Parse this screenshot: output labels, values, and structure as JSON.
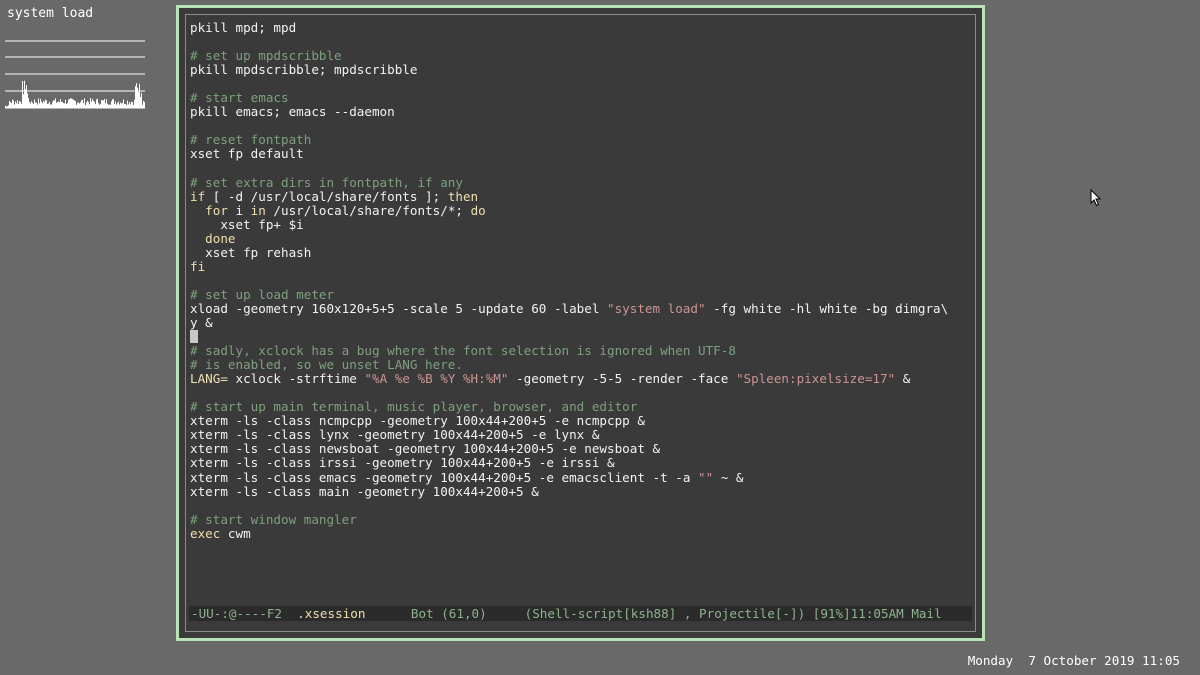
{
  "xload": {
    "label": "system load"
  },
  "editor": {
    "lines": [
      [
        {
          "t": "pkill mpd; mpd",
          "c": ""
        }
      ],
      [],
      [
        {
          "t": "# set up mpdscribble",
          "c": "cmt"
        }
      ],
      [
        {
          "t": "pkill mpdscribble; mpdscribble",
          "c": ""
        }
      ],
      [],
      [
        {
          "t": "# start emacs",
          "c": "cmt"
        }
      ],
      [
        {
          "t": "pkill emacs; emacs --daemon",
          "c": ""
        }
      ],
      [],
      [
        {
          "t": "# reset fontpath",
          "c": "cmt"
        }
      ],
      [
        {
          "t": "xset fp default",
          "c": ""
        }
      ],
      [],
      [
        {
          "t": "# set extra dirs in fontpath, if any",
          "c": "cmt"
        }
      ],
      [
        {
          "t": "if",
          "c": "kw"
        },
        {
          "t": " [ -d /usr/local/share/fonts ]; ",
          "c": ""
        },
        {
          "t": "then",
          "c": "kw"
        }
      ],
      [
        {
          "t": "  ",
          "c": ""
        },
        {
          "t": "for",
          "c": "kw"
        },
        {
          "t": " i ",
          "c": ""
        },
        {
          "t": "in",
          "c": "kw"
        },
        {
          "t": " /usr/local/share/fonts/*; ",
          "c": ""
        },
        {
          "t": "do",
          "c": "kw"
        }
      ],
      [
        {
          "t": "    xset fp+ $i",
          "c": ""
        }
      ],
      [
        {
          "t": "  ",
          "c": ""
        },
        {
          "t": "done",
          "c": "kw"
        }
      ],
      [
        {
          "t": "  xset fp rehash",
          "c": ""
        }
      ],
      [
        {
          "t": "fi",
          "c": "kw"
        }
      ],
      [],
      [
        {
          "t": "# set up load meter",
          "c": "cmt"
        }
      ],
      [
        {
          "t": "xload -geometry 160x120+5+5 -scale 5 -update 60 -label ",
          "c": ""
        },
        {
          "t": "\"system load\"",
          "c": "str"
        },
        {
          "t": " -fg white -hl white -bg dimgra\\",
          "c": ""
        }
      ],
      [
        {
          "t": "y &",
          "c": ""
        }
      ],
      [
        {
          "t": "",
          "c": "cursor"
        }
      ],
      [
        {
          "t": "# sadly, xclock has a bug where the font selection is ignored when UTF-8",
          "c": "cmt"
        }
      ],
      [
        {
          "t": "# is enabled, so we unset LANG here.",
          "c": "cmt"
        }
      ],
      [
        {
          "t": "LANG=",
          "c": "var"
        },
        {
          "t": " xclock -strftime ",
          "c": ""
        },
        {
          "t": "\"%A %e %B %Y %H:%M\"",
          "c": "str"
        },
        {
          "t": " -geometry -5-5 -render -face ",
          "c": ""
        },
        {
          "t": "\"Spleen:pixelsize=17\"",
          "c": "str"
        },
        {
          "t": " &",
          "c": ""
        }
      ],
      [],
      [
        {
          "t": "# start up main terminal, music player, browser, and editor",
          "c": "cmt"
        }
      ],
      [
        {
          "t": "xterm -ls -class ncmpcpp -geometry 100x44+200+5 -e ncmpcpp &",
          "c": ""
        }
      ],
      [
        {
          "t": "xterm -ls -class lynx -geometry 100x44+200+5 -e lynx &",
          "c": ""
        }
      ],
      [
        {
          "t": "xterm -ls -class newsboat -geometry 100x44+200+5 -e newsboat &",
          "c": ""
        }
      ],
      [
        {
          "t": "xterm -ls -class irssi -geometry 100x44+200+5 -e irssi &",
          "c": ""
        }
      ],
      [
        {
          "t": "xterm -ls -class emacs -geometry 100x44+200+5 -e emacsclient -t -a ",
          "c": ""
        },
        {
          "t": "\"\"",
          "c": "str"
        },
        {
          "t": " ~ &",
          "c": ""
        }
      ],
      [
        {
          "t": "xterm -ls -class main -geometry 100x44+200+5 &",
          "c": ""
        }
      ],
      [],
      [
        {
          "t": "# start window mangler",
          "c": "cmt"
        }
      ],
      [
        {
          "t": "exec",
          "c": "kw"
        },
        {
          "t": " cwm",
          "c": ""
        }
      ]
    ]
  },
  "modeline": {
    "status": "-UU-:@----F2  ",
    "buffer_name": ".xsession",
    "position": "      Bot (61,0)     ",
    "modes": "(Shell-script[ksh88] , Projectile[-]) [91%]11:05AM Mail"
  },
  "clock": {
    "text": "Monday  7 October 2019 11:05"
  },
  "colors": {
    "desktop_bg": "#696969",
    "window_border": "#b7e3b7",
    "editor_bg": "#3a3a3a",
    "comment": "#7f9f7f",
    "keyword": "#f0dfaf",
    "string": "#cc9393"
  },
  "icons": {
    "pointer": "mouse-pointer-icon"
  }
}
